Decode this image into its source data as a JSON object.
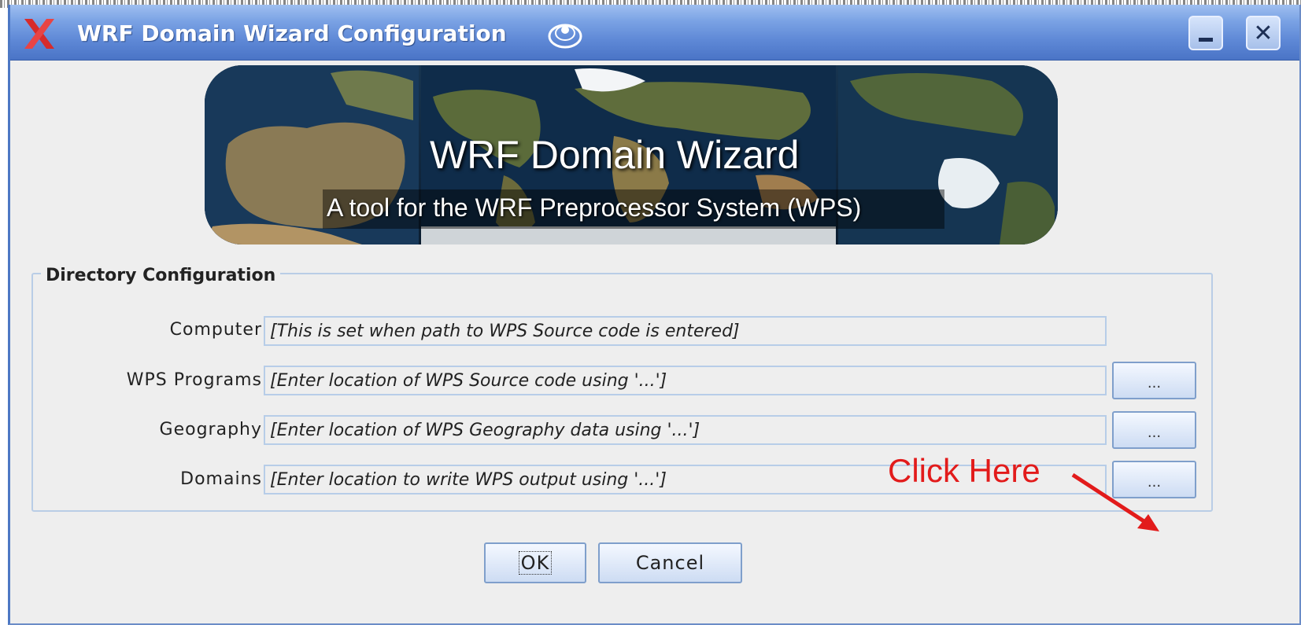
{
  "window": {
    "title": "WRF Domain Wizard Configuration",
    "controls": {
      "minimize_icon": "minimize-icon",
      "close_icon": "close-icon"
    }
  },
  "banner": {
    "title": "WRF Domain Wizard",
    "subtitle": "A tool for the WRF Preprocessor System (WPS)"
  },
  "directory_config": {
    "legend": "Directory Configuration",
    "rows": [
      {
        "label": "Computer",
        "value": "[This is set when path to WPS Source code is entered]",
        "has_browse": false
      },
      {
        "label": "WPS Programs",
        "value": "[Enter location of WPS Source code using '...']",
        "has_browse": true,
        "browse_label": "..."
      },
      {
        "label": "Geography",
        "value": "[Enter location of WPS Geography data using '...']",
        "has_browse": true,
        "browse_label": "..."
      },
      {
        "label": "Domains",
        "value": "[Enter location to write WPS output using '...']",
        "has_browse": true,
        "browse_label": "..."
      }
    ]
  },
  "annotation": {
    "text": "Click Here",
    "color": "#e21b1b"
  },
  "buttons": {
    "ok": "OK",
    "cancel": "Cancel"
  },
  "colors": {
    "titlebar": "#5e88d6",
    "field_border": "#b7cde8",
    "background": "#eeeeee"
  }
}
